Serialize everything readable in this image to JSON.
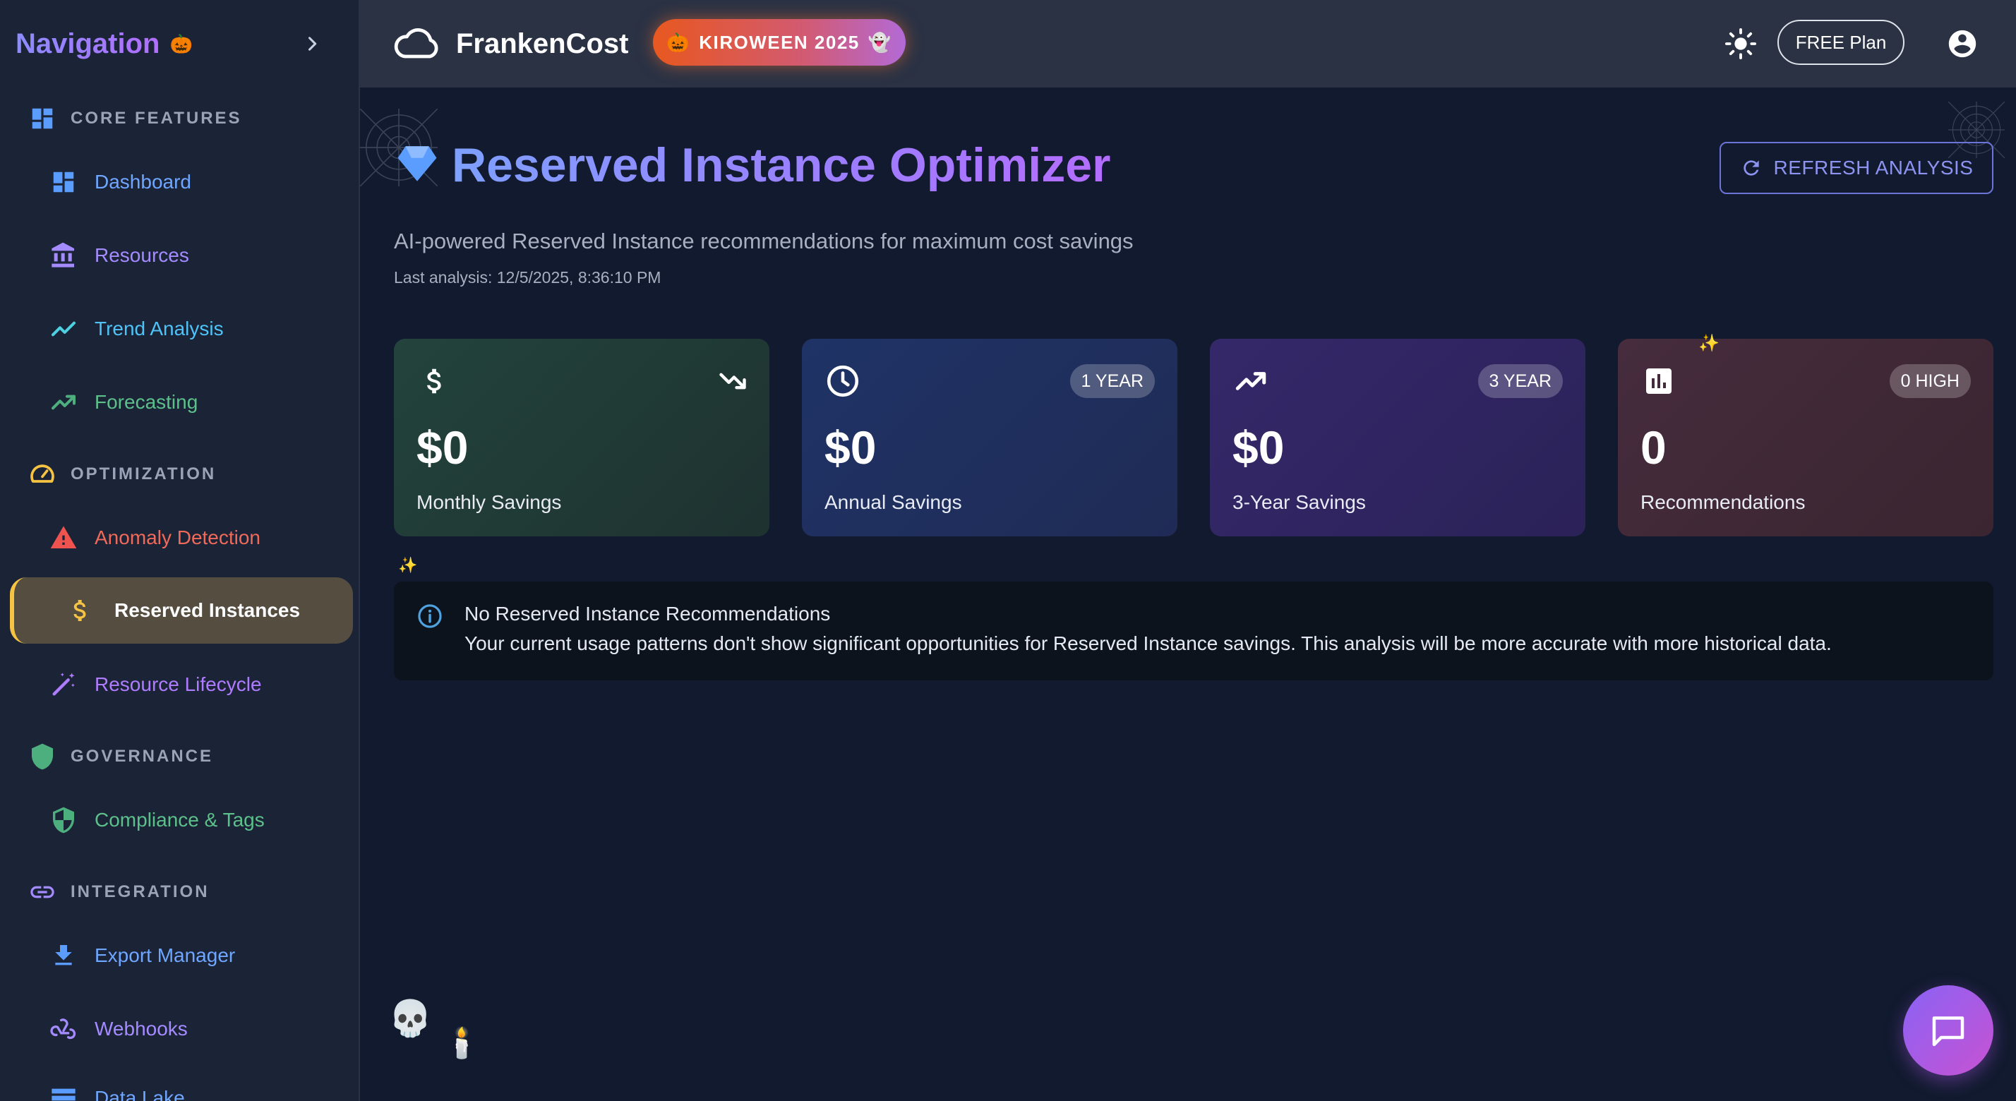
{
  "sidebar": {
    "title": "Navigation",
    "title_emoji": "🎃",
    "sections": {
      "core": "CORE FEATURES",
      "optimization": "OPTIMIZATION",
      "governance": "GOVERNANCE",
      "integration": "INTEGRATION"
    },
    "items": {
      "dashboard": "Dashboard",
      "resources": "Resources",
      "trend": "Trend Analysis",
      "forecasting": "Forecasting",
      "anomaly": "Anomaly Detection",
      "reserved": "Reserved Instances",
      "lifecycle": "Resource Lifecycle",
      "compliance": "Compliance & Tags",
      "export": "Export Manager",
      "webhooks": "Webhooks",
      "datalake": "Data Lake"
    }
  },
  "topbar": {
    "brand": "FrankenCost",
    "event_badge": "KIROWEEN 2025",
    "event_badge_left_emoji": "🎃",
    "event_badge_right_emoji": "👻",
    "plan": "FREE Plan"
  },
  "page": {
    "title": "Reserved Instance Optimizer",
    "refresh_label": "REFRESH ANALYSIS",
    "subtitle": "AI-powered Reserved Instance recommendations for maximum cost savings",
    "last_analysis": "Last analysis: 12/5/2025, 8:36:10 PM"
  },
  "cards": [
    {
      "value": "$0",
      "label": "Monthly Savings",
      "badge": ""
    },
    {
      "value": "$0",
      "label": "Annual Savings",
      "badge": "1 YEAR"
    },
    {
      "value": "$0",
      "label": "3-Year Savings",
      "badge": "3 YEAR"
    },
    {
      "value": "0",
      "label": "Recommendations",
      "badge": "0 HIGH"
    }
  ],
  "notice": {
    "title": "No Reserved Instance Recommendations",
    "body": "Your current usage patterns don't show significant opportunities for Reserved Instance savings. This analysis will be more accurate with more historical data."
  },
  "decor": {
    "sparkle": "✨",
    "skull": "💀",
    "candle": "🕯️"
  },
  "colors": {
    "accent_active": "#f6c343",
    "brand_gradient_start": "#7ea0ff",
    "brand_gradient_end": "#b46dff"
  }
}
